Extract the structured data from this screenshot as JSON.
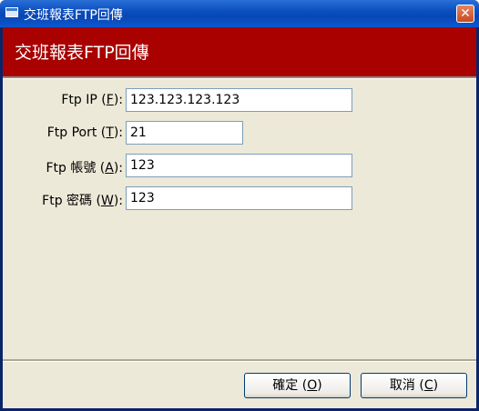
{
  "window": {
    "title": "交班報表FTP回傳",
    "close_glyph": "✕"
  },
  "header": {
    "heading": "交班報表FTP回傳"
  },
  "form": {
    "ip": {
      "label_pre": "Ftp IP (",
      "mnemonic": "F",
      "label_post": "):",
      "value": "123.123.123.123"
    },
    "port": {
      "label_pre": "Ftp Port (",
      "mnemonic": "T",
      "label_post": "):",
      "value": "21"
    },
    "account": {
      "label_pre": "Ftp 帳號 (",
      "mnemonic": "A",
      "label_post": "):",
      "value": "123"
    },
    "password": {
      "label_pre": "Ftp 密碼 (",
      "mnemonic": "W",
      "label_post": "):",
      "value": "123"
    }
  },
  "buttons": {
    "ok": {
      "pre": "確定 (",
      "mnemonic": "O",
      "post": ")"
    },
    "cancel": {
      "pre": "取消 (",
      "mnemonic": "C",
      "post": ")"
    }
  },
  "icons": {
    "app": "window-icon",
    "close": "close-icon"
  }
}
